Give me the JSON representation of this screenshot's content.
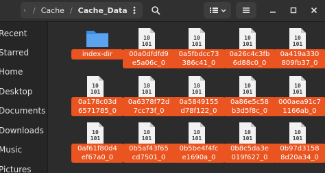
{
  "path_bar": {
    "crumbs": [
      "Cache",
      "Cache_Data"
    ],
    "separator": "/"
  },
  "icons": {
    "back": "chevron-left-icon",
    "menu": "vertical-dots-icon",
    "search": "search-icon",
    "view": "list-view-icon",
    "hamburger": "menu-icon",
    "minimize": "minimize-icon",
    "maximize": "maximize-icon",
    "close": "close-icon"
  },
  "sidebar": {
    "items": [
      {
        "label": "Recent",
        "icon": "clock-icon"
      },
      {
        "label": "Starred",
        "icon": "star-icon"
      },
      {
        "label": "Home",
        "icon": "home-icon"
      },
      {
        "label": "Desktop",
        "icon": "desktop-icon"
      },
      {
        "label": "Documents",
        "icon": "documents-icon"
      },
      {
        "label": "Downloads",
        "icon": "downloads-icon"
      },
      {
        "label": "Music",
        "icon": "music-icon"
      },
      {
        "label": "Pictures",
        "icon": "pictures-icon"
      }
    ]
  },
  "files": {
    "rows": [
      [
        {
          "type": "folder",
          "lines": [
            "index-dir"
          ]
        },
        {
          "type": "binary",
          "lines": [
            "00a0dfdfd9",
            "e5a06c_0"
          ]
        },
        {
          "type": "binary",
          "lines": [
            "0a5fbdcc73",
            "386c41_0"
          ]
        },
        {
          "type": "binary",
          "lines": [
            "0a26c4c3fb",
            "6d88c0_0"
          ]
        },
        {
          "type": "binary",
          "lines": [
            "0a419a330",
            "809fb37_0"
          ]
        }
      ],
      [
        {
          "type": "binary",
          "lines": [
            "0a178c03d",
            "6571785_0"
          ]
        },
        {
          "type": "binary",
          "lines": [
            "0a6378f72d",
            "7cc73f_0"
          ]
        },
        {
          "type": "binary",
          "lines": [
            "0a5849155",
            "d78f122_0"
          ]
        },
        {
          "type": "binary",
          "lines": [
            "0a86e5c58",
            "b3d5f8c_0"
          ]
        },
        {
          "type": "binary",
          "lines": [
            "000aea91c7",
            "1166ab_0"
          ]
        }
      ],
      [
        {
          "type": "binary",
          "lines": [
            "0af61f80d4",
            "ef67a0_0"
          ]
        },
        {
          "type": "binary",
          "lines": [
            "0b5af43f65",
            "cd7501_0"
          ]
        },
        {
          "type": "binary",
          "lines": [
            "0b5be4f4fc",
            "e1690a_0"
          ]
        },
        {
          "type": "binary",
          "lines": [
            "0b8c5da3e",
            "019f627_0"
          ]
        },
        {
          "type": "binary",
          "lines": [
            "0b97d3158",
            "8d20a34_0"
          ]
        }
      ]
    ],
    "binary_glyph": [
      "10",
      "101"
    ]
  },
  "colors": {
    "selection": "#e95420",
    "folder": "#3c8de0",
    "window_bg": "#2c2c2c"
  }
}
